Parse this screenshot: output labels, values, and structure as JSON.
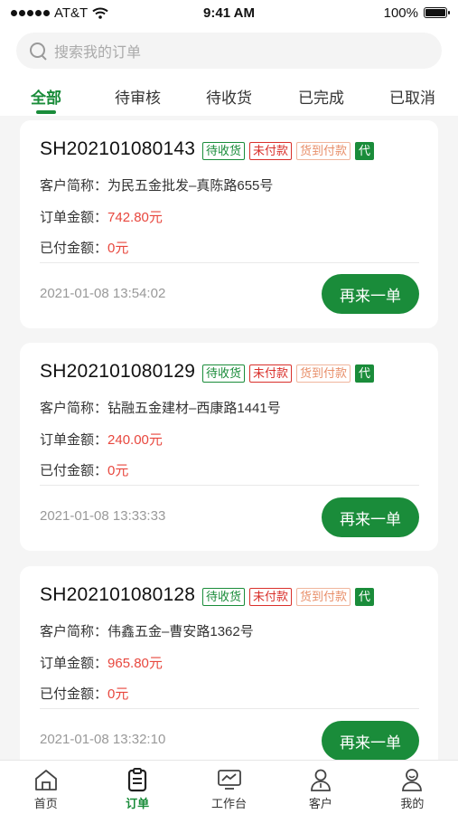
{
  "status_bar": {
    "carrier": "AT&T",
    "time": "9:41 AM",
    "battery": "100%"
  },
  "search": {
    "placeholder": "搜索我的订单"
  },
  "tabs": [
    {
      "label": "全部",
      "active": true
    },
    {
      "label": "待审核",
      "active": false
    },
    {
      "label": "待收货",
      "active": false
    },
    {
      "label": "已完成",
      "active": false
    },
    {
      "label": "已取消",
      "active": false
    }
  ],
  "labels": {
    "customer": "客户简称：",
    "order_amount": "订单金额：",
    "paid_amount": "已付金额："
  },
  "orders": [
    {
      "order_no": "SH202101080143",
      "tags": [
        "待收货",
        "未付款",
        "货到付款",
        "代"
      ],
      "customer": "为民五金批发–真陈路655号",
      "amount": "742.80元",
      "paid": "0元",
      "time": "2021-01-08 13:54:02",
      "button": "再来一单"
    },
    {
      "order_no": "SH202101080129",
      "tags": [
        "待收货",
        "未付款",
        "货到付款",
        "代"
      ],
      "customer": "钻融五金建材–西康路1441号",
      "amount": "240.00元",
      "paid": "0元",
      "time": "2021-01-08 13:33:33",
      "button": "再来一单"
    },
    {
      "order_no": "SH202101080128",
      "tags": [
        "待收货",
        "未付款",
        "货到付款",
        "代"
      ],
      "customer": "伟鑫五金–曹安路1362号",
      "amount": "965.80元",
      "paid": "0元",
      "time": "2021-01-08 13:32:10",
      "button": "再来一单"
    }
  ],
  "bottom_nav": [
    {
      "label": "首页",
      "icon": "home-icon",
      "active": false
    },
    {
      "label": "订单",
      "icon": "order-clipboard-icon",
      "active": true
    },
    {
      "label": "工作台",
      "icon": "workbench-monitor-icon",
      "active": false
    },
    {
      "label": "客户",
      "icon": "customer-person-icon",
      "active": false
    },
    {
      "label": "我的",
      "icon": "profile-icon",
      "active": false
    }
  ],
  "colors": {
    "accent": "#1a8c3a",
    "amount_red": "#e8473e",
    "tag_red": "#d9302b",
    "tag_orange": "#e88f6a"
  }
}
